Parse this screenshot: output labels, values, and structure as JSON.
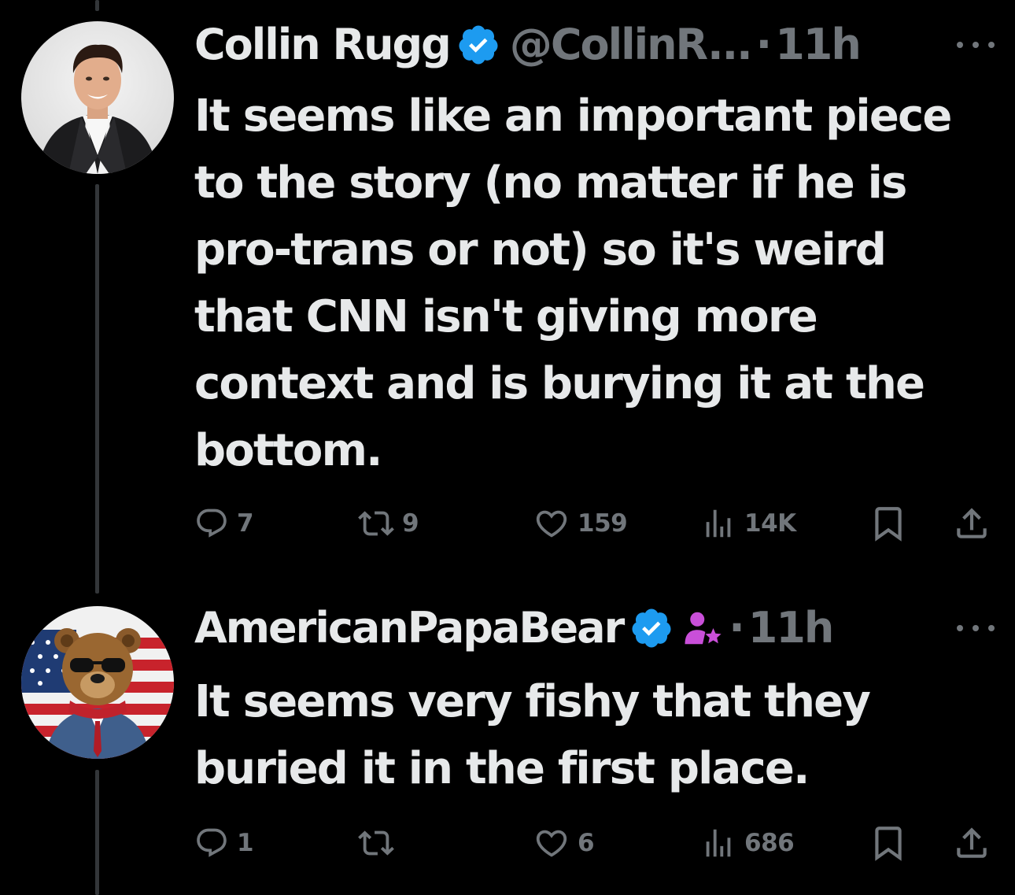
{
  "colors": {
    "background": "#000000",
    "text": "#e7e9ea",
    "muted": "#71767b",
    "verified": "#1d9bf0",
    "affiliate_badge": "#c94fd9",
    "thread_line": "#333639"
  },
  "tweets": [
    {
      "author": "Collin Rugg",
      "verified": true,
      "handle": "@CollinR...",
      "separator": "·",
      "time": "11h",
      "text": "It seems like an important piece to the story (no matter if he is pro-trans or not) so it's weird that CNN isn't giving more context and is burying it at the bottom.",
      "avatar_icon": "portrait-man-suit",
      "actions": {
        "replies": "7",
        "retweets": "9",
        "likes": "159",
        "views": "14K"
      }
    },
    {
      "author": "AmericanPapaBear",
      "verified": true,
      "affiliate_icon": "person-star-icon",
      "separator": "·",
      "time": "11h",
      "text": "It seems very fishy that they buried it in the first place.",
      "avatar_icon": "bear-sunglasses-flag",
      "actions": {
        "replies": "1",
        "retweets": "",
        "likes": "6",
        "views": "686"
      }
    }
  ],
  "icons": {
    "reply": "reply-icon",
    "retweet": "retweet-icon",
    "like": "heart-icon",
    "views": "views-chart-icon",
    "bookmark": "bookmark-icon",
    "share": "share-icon",
    "more": "more-dots-icon",
    "verified": "verified-badge-icon"
  }
}
